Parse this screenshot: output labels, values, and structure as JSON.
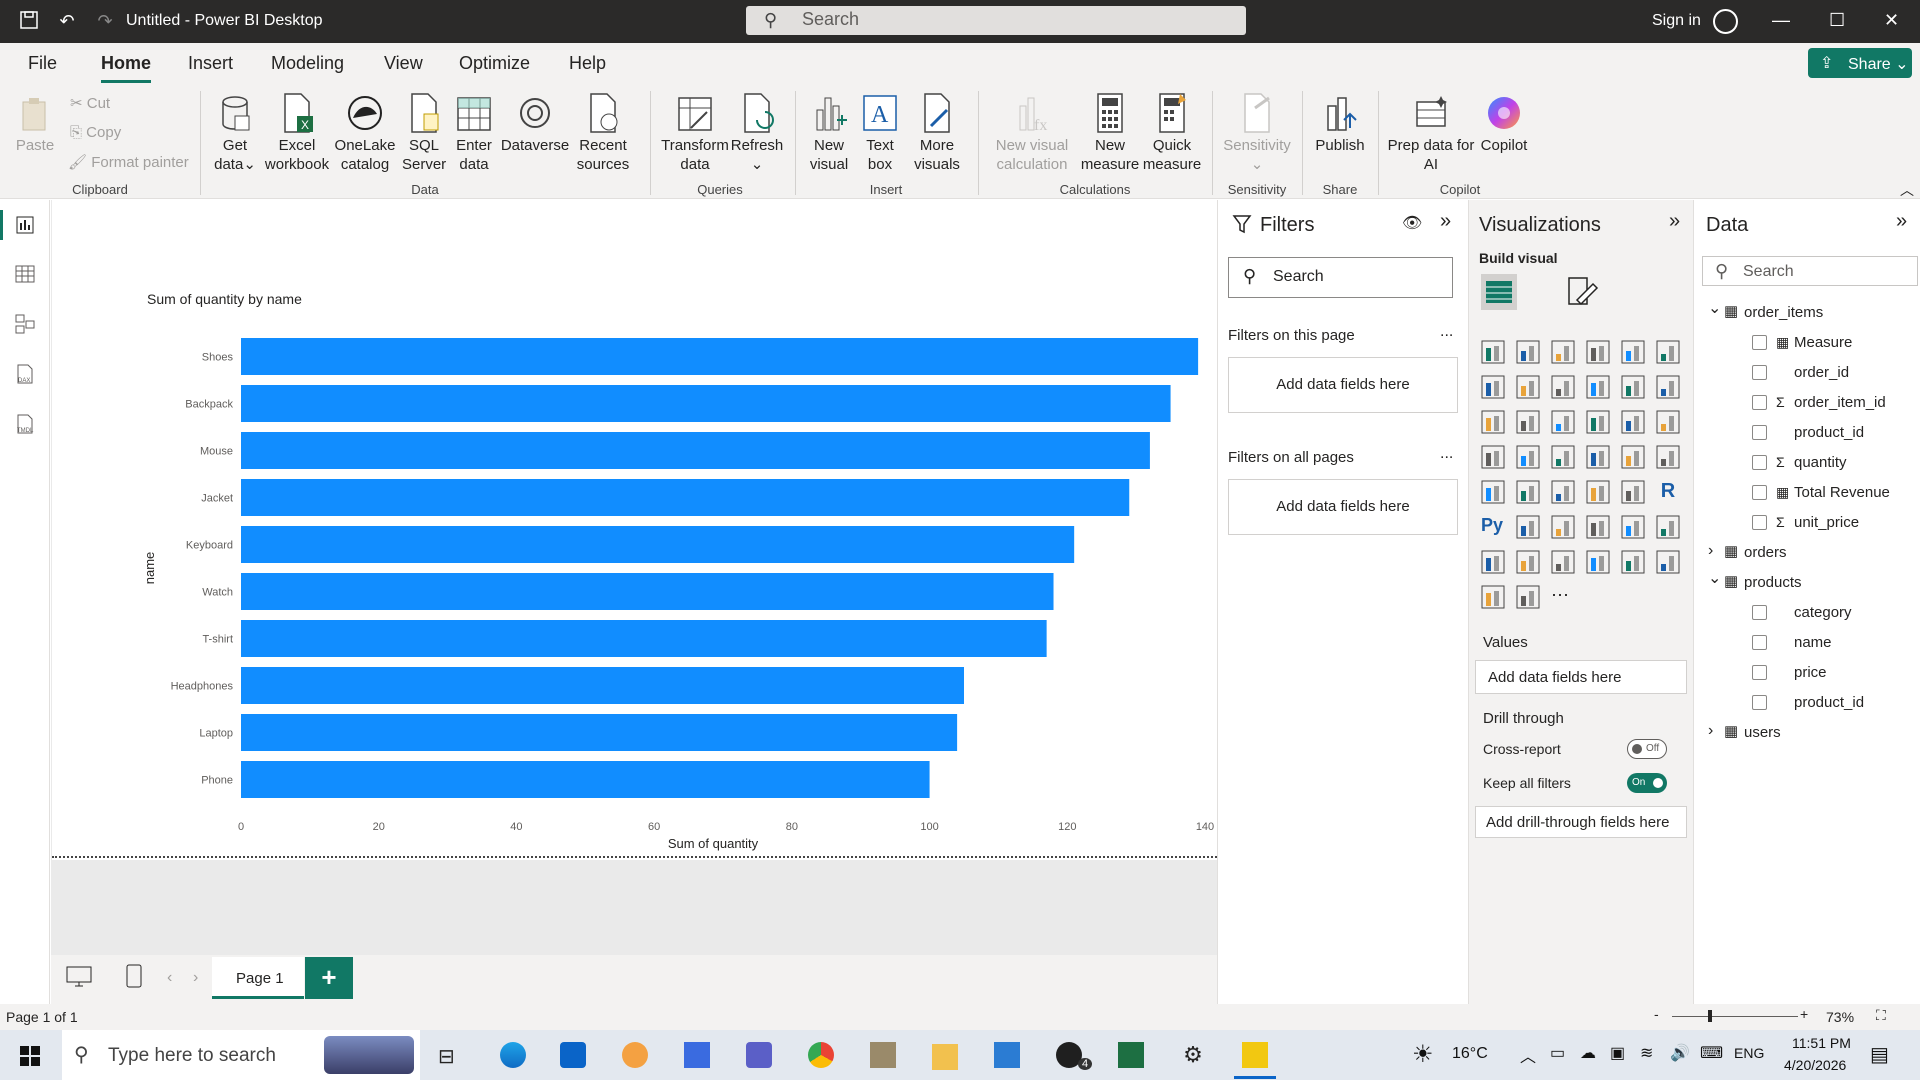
{
  "window": {
    "title": "Untitled - Power BI Desktop",
    "search_placeholder": "Search",
    "sign_in": "Sign in"
  },
  "menu": {
    "items": [
      "File",
      "Home",
      "Insert",
      "Modeling",
      "View",
      "Optimize",
      "Help"
    ],
    "active": "Home",
    "share": "Share"
  },
  "ribbon": {
    "clipboard": {
      "paste": "Paste",
      "cut": "Cut",
      "copy": "Copy",
      "format_painter": "Format painter",
      "group": "Clipboard"
    },
    "data": {
      "get_data": "Get data",
      "excel": "Excel workbook",
      "onelake": "OneLake catalog",
      "sql": "SQL Server",
      "enter": "Enter data",
      "dataverse": "Dataverse",
      "recent": "Recent sources",
      "group": "Data"
    },
    "queries": {
      "transform": "Transform data",
      "refresh": "Refresh",
      "group": "Queries"
    },
    "insert": {
      "new_visual": "New visual",
      "text_box": "Text box",
      "more_visuals": "More visuals",
      "group": "Insert"
    },
    "calculations": {
      "new_visual_calc": "New visual calculation",
      "new_measure": "New measure",
      "quick_measure": "Quick measure",
      "group": "Calculations"
    },
    "sensitivity": {
      "label": "Sensitivity",
      "group": "Sensitivity"
    },
    "share": {
      "publish": "Publish",
      "group": "Share"
    },
    "copilot": {
      "prep": "Prep data for AI",
      "copilot": "Copilot",
      "group": "Copilot"
    }
  },
  "chart_data": {
    "type": "bar",
    "orientation": "horizontal",
    "title": "Sum of quantity by name",
    "xlabel": "Sum of quantity",
    "ylabel": "name",
    "categories": [
      "Shoes",
      "Backpack",
      "Mouse",
      "Jacket",
      "Keyboard",
      "Watch",
      "T-shirt",
      "Headphones",
      "Laptop",
      "Phone"
    ],
    "values": [
      139,
      135,
      132,
      129,
      121,
      118,
      117,
      105,
      104,
      100
    ],
    "xlim": [
      0,
      140
    ],
    "xticks": [
      "0",
      "20",
      "40",
      "60",
      "80",
      "100",
      "120",
      "140"
    ],
    "color": "#118dff"
  },
  "pages": {
    "tab": "Page 1",
    "add": "+",
    "status": "Page 1 of 1",
    "zoom": "73%"
  },
  "filters": {
    "title": "Filters",
    "search": "Search",
    "this_page": "Filters on this page",
    "all_pages": "Filters on all pages",
    "add_fields": "Add data fields here",
    "more": "..."
  },
  "visualizations": {
    "title": "Visualizations",
    "build": "Build visual",
    "values": "Values",
    "add_fields": "Add data fields here",
    "drill": "Drill through",
    "cross_report": "Cross-report",
    "cross_state": "Off",
    "keep_filters": "Keep all filters",
    "keep_state": "On",
    "add_drill": "Add drill-through fields here"
  },
  "data_pane": {
    "title": "Data",
    "search": "Search",
    "tables": [
      {
        "name": "order_items",
        "expanded": true,
        "fields": [
          "Measure",
          "order_id",
          "order_item_id",
          "product_id",
          "quantity",
          "Total Revenue",
          "unit_price"
        ]
      },
      {
        "name": "orders",
        "expanded": false,
        "fields": []
      },
      {
        "name": "products",
        "expanded": true,
        "fields": [
          "category",
          "name",
          "price",
          "product_id"
        ]
      },
      {
        "name": "users",
        "expanded": false,
        "fields": []
      }
    ]
  },
  "taskbar": {
    "search": "Type here to search",
    "temp": "16°C",
    "lang": "ENG",
    "time": "11:51 PM",
    "date": "4/20/2026",
    "whatsapp_badge": "4"
  },
  "colors": {
    "accent": "#117865",
    "bar": "#118dff",
    "titlebar": "#2b2a29"
  }
}
